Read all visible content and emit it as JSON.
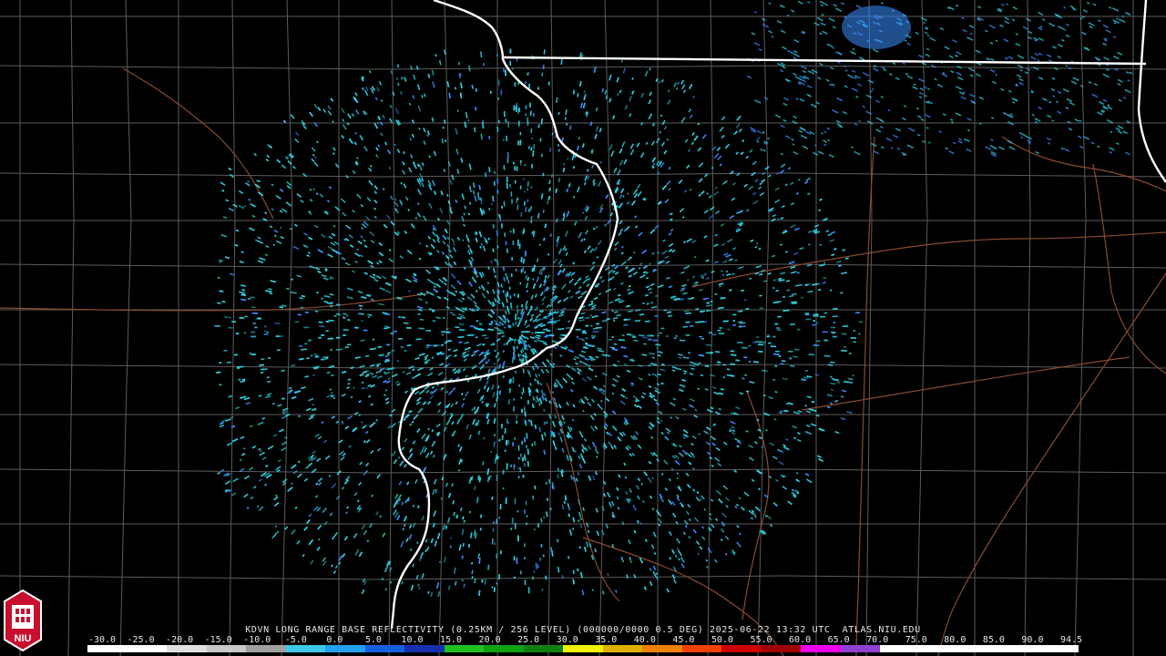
{
  "map": {
    "caption": "KDVN LONG RANGE BASE REFLECTIVITY (0.25KM / 256 LEVEL) (000000/0000 0.5 DEG) 2025-06-22 13:32 UTC  ATLAS.NIU.EDU",
    "station": "KDVN",
    "product": "LONG RANGE BASE REFLECTIVITY",
    "resolution": "0.25KM / 256 LEVEL",
    "tilt": "0.5 DEG",
    "datetime": "2025-06-22 13:32 UTC",
    "source": "ATLAS.NIU.EDU",
    "logo_text": "NIU",
    "colors": {
      "background": "#000000",
      "county_lines": "#5c5c5c",
      "state_lines": "#ffffff",
      "roads": "#8a4a30",
      "echo_primary": "#2fd0e0",
      "echo_secondary": "#3a8cff"
    },
    "scale": {
      "labels": [
        "-30.0",
        "-25.0",
        "-20.0",
        "-15.0",
        "-10.0",
        "-5.0",
        "0.0",
        "5.0",
        "10.0",
        "15.0",
        "20.0",
        "25.0",
        "30.0",
        "35.0",
        "40.0",
        "45.0",
        "50.0",
        "55.0",
        "60.0",
        "65.0",
        "70.0",
        "75.0",
        "80.0",
        "85.0",
        "90.0",
        "94.5"
      ],
      "colors": [
        "#ffffff",
        "#ffffff",
        "#e0e0e0",
        "#c8c8c8",
        "#a0a0a0",
        "#3ec8e8",
        "#22a0f0",
        "#1460e0",
        "#1830b0",
        "#20c020",
        "#10a010",
        "#108010",
        "#f0f000",
        "#e0b000",
        "#f08000",
        "#f04000",
        "#d00000",
        "#a00000",
        "#f000f0",
        "#9040d0",
        "#ffffff",
        "#ffffff",
        "#ffffff",
        "#ffffff",
        "#ffffff"
      ]
    }
  }
}
